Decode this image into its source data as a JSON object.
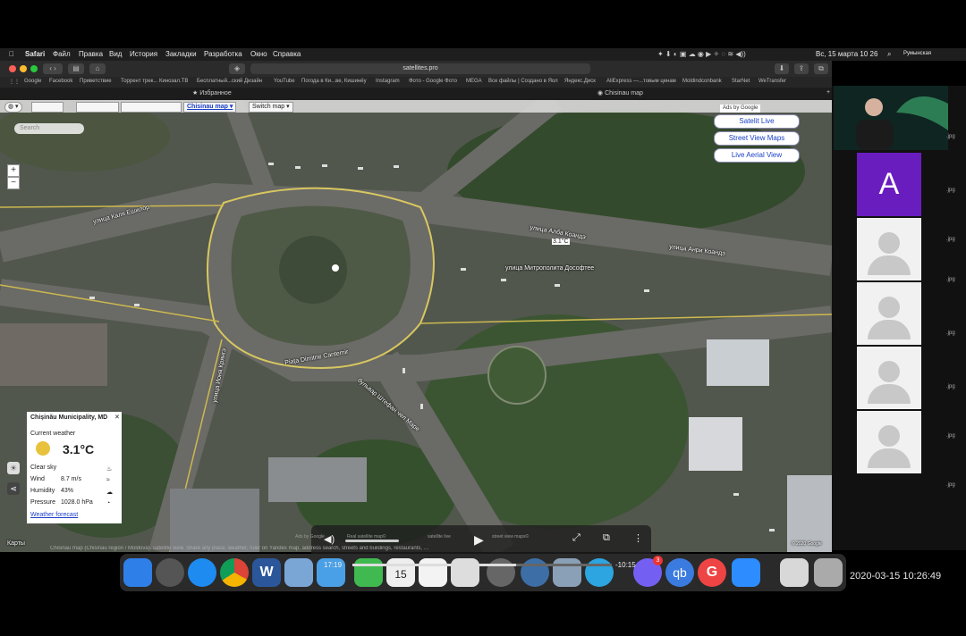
{
  "menubar": {
    "apple": "",
    "app": "Safari",
    "items": [
      "Файл",
      "Правка",
      "Вид",
      "История",
      "Закладки",
      "Разработка",
      "Окно",
      "Справка"
    ],
    "clock": "Вс, 15 марта  10 26",
    "keyboard": "Румынская"
  },
  "browser": {
    "url": "satellites.pro",
    "favorites": [
      "Google",
      "Facebook",
      "Приветствие",
      "Торрент трек... Кинозал.ТВ",
      "Бесплатный...ский Дизайн",
      "YouTube",
      "Погода в Ки...ве, Кишинёу",
      "Instagram",
      "Фото - Google Фото",
      "MEGA",
      "Все файлы | Создано в Яол",
      "Яндекс.Диск",
      "AliExpress —...товым ценам",
      "Moldindconbank",
      "StarNet",
      "WeTransfer"
    ],
    "tabs": [
      "Избранное",
      "Chisinau map"
    ]
  },
  "map": {
    "view_select": "Chisinau map",
    "switch_select": "Switch map",
    "search_placeholder": "Search",
    "zoom_in": "+",
    "zoom_out": "−",
    "ads_label": "Ads by Google",
    "buttons": [
      "Satelit Live",
      "Street View Maps",
      "Live Aerial View"
    ],
    "street_labels": [
      "улица Каля Ешилор",
      "улица Алба Коандэ",
      "улица Анри Коандэ",
      "улица Митрополита Дософтее",
      "улица Иона Крянгэ",
      "Piața Dimitrie Cantemir",
      "бульвар Штефан чел Маре"
    ],
    "marker_temp": "3.1°C",
    "karty": "Карты",
    "copyright": "© 2020 Google"
  },
  "weather": {
    "place": "Chișinău Municipality, MD",
    "subtitle": "Current weather",
    "temp": "3.1°C",
    "condition": "Clear sky",
    "wind_label": "Wind",
    "wind": "8.7 m/s",
    "humidity_label": "Humidity",
    "humidity": "43%",
    "pressure_label": "Pressure",
    "pressure": "1028.0 hPa",
    "forecast_link": "Weather forecast"
  },
  "status": {
    "line": "Chisinau map (Chisinau region / Moldova), satellite view. Share any place, weather, ruler on Yandex map, address search, streets and buildings, restaurants, …"
  },
  "video": {
    "elapsed": "17:19",
    "remaining": "-10:15",
    "progress": 0.63,
    "tabs_under": [
      "Ads by Google",
      "Real satellite map©",
      "satellite live",
      "street view maps©"
    ]
  },
  "zoom": {
    "avatar_letter": "A",
    "participants": 4,
    "file_ext": ".jpg"
  },
  "dock": {
    "badge": "3",
    "timestamp": "2020-03-15  10:26:49"
  }
}
